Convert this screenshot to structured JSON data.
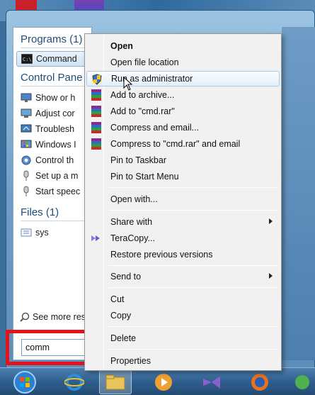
{
  "programs": {
    "title": "Programs (1)",
    "items": [
      {
        "label": "Command",
        "icon": "cmd-icon"
      }
    ]
  },
  "control_panel": {
    "title": "Control Pane",
    "items": [
      {
        "label": "Show or h",
        "icon": "display-icon"
      },
      {
        "label": "Adjust cor",
        "icon": "screen-icon"
      },
      {
        "label": "Troublesh",
        "icon": "troubleshoot-icon"
      },
      {
        "label": "Windows I",
        "icon": "windows-icon"
      },
      {
        "label": "Control th",
        "icon": "gear-icon"
      },
      {
        "label": "Set up a m",
        "icon": "microphone-icon"
      },
      {
        "label": "Start speec",
        "icon": "microphone-icon"
      }
    ]
  },
  "files": {
    "title": "Files (1)",
    "items": [
      {
        "label": "sys",
        "icon": "file-icon"
      }
    ]
  },
  "see_more": "See more res",
  "search": {
    "value": "comm"
  },
  "context_menu": {
    "items": [
      {
        "label": "Open",
        "bold": true
      },
      {
        "label": "Open file location"
      },
      {
        "label": "Run as administrator",
        "icon": "shield-icon",
        "highlighted": true
      },
      {
        "label": "Add to archive...",
        "icon": "winrar-icon"
      },
      {
        "label": "Add to \"cmd.rar\"",
        "icon": "winrar-icon"
      },
      {
        "label": "Compress and email...",
        "icon": "winrar-icon"
      },
      {
        "label": "Compress to \"cmd.rar\" and email",
        "icon": "winrar-icon"
      },
      {
        "label": "Pin to Taskbar"
      },
      {
        "label": "Pin to Start Menu"
      },
      {
        "label": "Open with..."
      },
      {
        "label": "Share with",
        "submenu": true
      },
      {
        "label": "TeraCopy...",
        "icon": "teracopy-icon"
      },
      {
        "label": "Restore previous versions"
      },
      {
        "label": "Send to",
        "submenu": true
      },
      {
        "label": "Cut"
      },
      {
        "label": "Copy"
      },
      {
        "label": "Delete"
      },
      {
        "label": "Properties"
      }
    ]
  },
  "taskbar": {
    "items": [
      "start-orb-icon",
      "internet-explorer-icon",
      "folder-icon",
      "media-player-icon",
      "visual-studio-icon",
      "firefox-icon"
    ]
  },
  "colors": {
    "menu_bg": "#f1f1f1",
    "highlight_border": "#a8c8e8",
    "annotation_red": "#e3131b",
    "group_title": "#1e4e79"
  }
}
